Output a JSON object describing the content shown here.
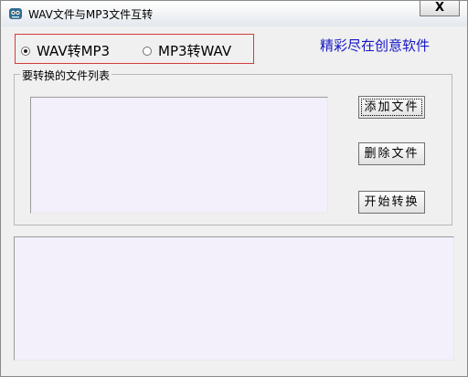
{
  "window": {
    "title": "WAV文件与MP3文件互转",
    "close_label": "X"
  },
  "mode": {
    "options": [
      {
        "label": "WAV转MP3",
        "selected": true
      },
      {
        "label": "MP3转WAV",
        "selected": false
      }
    ]
  },
  "slogan": "精彩尽在创意软件",
  "file_group": {
    "label": "要转换的文件列表",
    "items": []
  },
  "buttons": {
    "add": "添加文件",
    "delete": "删除文件",
    "start": "开始转换"
  },
  "output": {
    "text": ""
  },
  "colors": {
    "accent_text": "#1515c8",
    "highlight_border": "#d23b3b",
    "list_background": "#f3f0fb"
  }
}
